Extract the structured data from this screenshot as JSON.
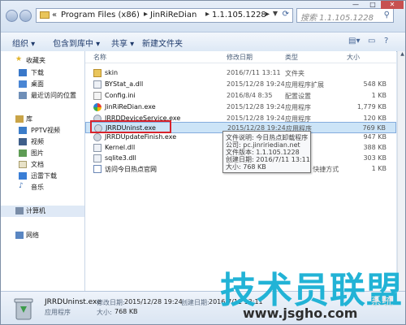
{
  "address_bar": {
    "crumbs": [
      "«",
      "Program Files (x86)",
      "JinRiReDian",
      "1.1.105.1228"
    ],
    "search_placeholder": "搜索 1.1.105.1228"
  },
  "window_controls": {
    "minimize": "—",
    "maximize": "□",
    "close": "✕"
  },
  "toolbar": {
    "organize": "组织 ▾",
    "include_in_library": "包含到库中 ▾",
    "share_with": "共享 ▾",
    "new_folder": "新建文件夹"
  },
  "nav": {
    "favorites": "收藏夹",
    "downloads": "下载",
    "desktop": "桌面",
    "recent": "最近访问的位置",
    "libraries": "库",
    "pptv": "PPTV视频",
    "videos": "视频",
    "pictures": "图片",
    "documents": "文档",
    "thunder": "迅雷下载",
    "music": "音乐",
    "computer": "计算机",
    "network": "网络"
  },
  "columns": {
    "name": "名称",
    "date": "修改日期",
    "type": "类型",
    "size": "大小"
  },
  "files": [
    {
      "name": "skin",
      "date": "2016/7/11 13:11",
      "type": "文件夹",
      "size": "",
      "icon": "folder"
    },
    {
      "name": "BYStat_a.dll",
      "date": "2015/12/28 19:24",
      "type": "应用程序扩展",
      "size": "548 KB",
      "icon": "dll"
    },
    {
      "name": "Config.ini",
      "date": "2016/8/4 8:35",
      "type": "配置设置",
      "size": "1 KB",
      "icon": "ini"
    },
    {
      "name": "JinRiReDian.exe",
      "date": "2015/12/28 19:24",
      "type": "应用程序",
      "size": "1,779 KB",
      "icon": "app"
    },
    {
      "name": "JRRDDeviceService.exe",
      "date": "2015/12/28 19:24",
      "type": "应用程序",
      "size": "120 KB",
      "icon": "exe"
    },
    {
      "name": "JRRDUninst.exe",
      "date": "2015/12/28 19:24",
      "type": "应用程序",
      "size": "769 KB",
      "icon": "exe"
    },
    {
      "name": "JRRDUpdateFinish.exe",
      "date": "",
      "type": "",
      "size": "947 KB",
      "icon": "exe"
    },
    {
      "name": "Kernel.dll",
      "date": "",
      "type": "",
      "size": "388 KB",
      "icon": "dll"
    },
    {
      "name": "sqlite3.dll",
      "date": "",
      "type": "",
      "size": "303 KB",
      "icon": "dll"
    },
    {
      "name": "访问今日热点官网",
      "date": "",
      "type": "Internet 快捷方式",
      "size": "1 KB",
      "icon": "url"
    }
  ],
  "tooltip": {
    "line1": "文件说明: 今日热点卸载程序",
    "line2": "公司: pc.jinririedian.net",
    "line3": "文件版本: 1.1.105.1228",
    "line4": "创建日期: 2016/7/11 13:11",
    "line5": "大小: 768 KB"
  },
  "details": {
    "filename": "JRRDUninst.exe",
    "modified_label": "修改日期:",
    "modified_value": "2015/12/28 19:24",
    "created_label": "创建日期:",
    "created_value": "2016/7/11 13:11",
    "type": "应用程序",
    "size_label": "大小:",
    "size_value": "768 KB"
  },
  "watermark": {
    "main": "技术员联盟",
    "url": "www.jsgho.com",
    "side": "系统"
  },
  "colors": {
    "highlight_border": "#d8222b",
    "selected_row": "#cce4f7",
    "watermark": "#22b3d6"
  }
}
